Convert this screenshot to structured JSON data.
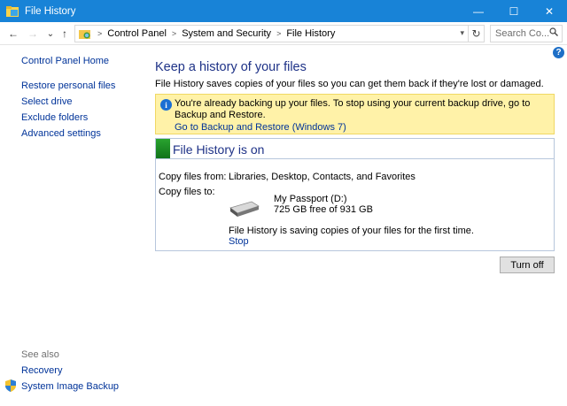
{
  "window": {
    "title": "File History",
    "controls": {
      "minimize": "—",
      "maximize": "☐",
      "close": "✕"
    }
  },
  "nav": {
    "back_glyph": "←",
    "forward_glyph": "→",
    "recent_glyph": "⌄",
    "up_glyph": "↑",
    "breadcrumbs": [
      "Control Panel",
      "System and Security",
      "File History"
    ],
    "separator": ">",
    "search_placeholder": "Search Co..."
  },
  "sidebar": {
    "home": "Control Panel Home",
    "items": [
      "Restore personal files",
      "Select drive",
      "Exclude folders",
      "Advanced settings"
    ],
    "see_also_label": "See also",
    "see_also_items": [
      "Recovery",
      "System Image Backup"
    ]
  },
  "main": {
    "title": "Keep a history of your files",
    "description": "File History saves copies of your files so you can get them back if they're lost or damaged.",
    "info": {
      "message": "You're already backing up your files. To stop using your current backup drive, go to Backup and Restore.",
      "link": "Go to Backup and Restore (Windows 7)"
    },
    "status": {
      "heading": "File History is on",
      "copy_from_label": "Copy files from:",
      "copy_from_value": "Libraries, Desktop, Contacts, and Favorites",
      "copy_to_label": "Copy files to:",
      "drive_name": "My Passport (D:)",
      "drive_free": "725 GB free of 931 GB",
      "saving_text": "File History is saving copies of your files for the first time.",
      "stop_link": "Stop"
    },
    "turn_off_button": "Turn off"
  },
  "colors": {
    "titlebar": "#1883d7",
    "heading": "#1e3287",
    "link": "#003399",
    "info_bg": "#fff2a8",
    "status_green": "#1f8f27"
  }
}
